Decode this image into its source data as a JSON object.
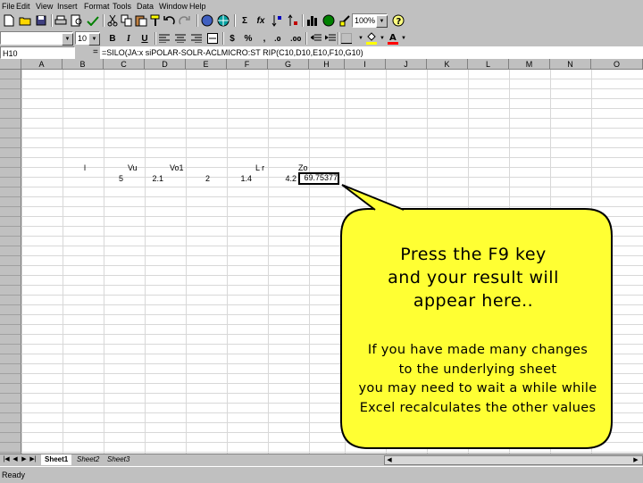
{
  "menu": [
    "File",
    "Edit",
    "View",
    "Insert",
    "Format",
    "Tools",
    "Data",
    "Window",
    "Help"
  ],
  "toolbar": {
    "zoom_value": "100%",
    "font_size_value": "10",
    "bold_label": "B",
    "italic_label": "I",
    "underline_label": "U",
    "sum_label": "Σ",
    "function_label": "fx",
    "currency_label": "$",
    "percent_label": "%",
    "comma_label": ","
  },
  "formula_bar": {
    "name_box": "H10",
    "equals_label": "=",
    "formula": "=SILO(JA:x siPOLAR-SOLR-ACLMICRO:ST RIP(C10,D10,E10,F10,G10)"
  },
  "columns": [
    "A",
    "B",
    "C",
    "D",
    "E",
    "F",
    "G",
    "H",
    "I",
    "J",
    "K",
    "L",
    "M",
    "N",
    "O"
  ],
  "cells": {
    "header_row": [
      "l",
      "Vu",
      "Vo1",
      "L r",
      "Zo"
    ],
    "value_row": [
      "5",
      "2.1",
      "2",
      "1.4",
      "4.2"
    ],
    "result": "69.75377"
  },
  "sheets": [
    "Sheet1",
    "Sheet2",
    "Sheet3"
  ],
  "status": "Ready",
  "callout": {
    "main_line1": "Press the F9 key",
    "main_line2": "and your result will",
    "main_line3": "appear here..",
    "note_line1": "If you have made many changes",
    "note_line2": "to the underlying sheet",
    "note_line3": "you may need to wait a while while",
    "note_line4": "Excel recalculates the other values"
  },
  "colors": {
    "callout_fill": "#ffff33",
    "callout_stroke": "#000000",
    "chrome": "#c0c0c0"
  }
}
